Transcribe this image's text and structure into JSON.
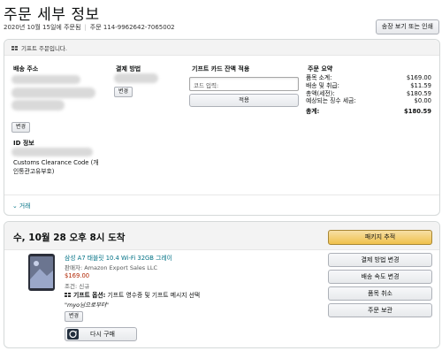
{
  "header": {
    "title": "주문 세부 정보",
    "order_date": "2020년 10월 15일에 주문됨",
    "order_number": "주문 114-9962642-7065002",
    "invoice_button": "송장 보기 또는 인쇄"
  },
  "gift_notice": "기프트 주문입니다.",
  "shipping": {
    "heading": "배송 주소",
    "change_button": "변경",
    "id_heading": "ID 정보",
    "customs_text": "Customs Clearance Code (개인통관고유부호)"
  },
  "payment": {
    "heading": "결제 방법",
    "change_button": "변경"
  },
  "gift_card": {
    "heading": "기프트 카드 잔액 적용",
    "placeholder": "코드 입력:",
    "apply_button": "적용"
  },
  "summary": {
    "heading": "주문 요약",
    "rows": [
      {
        "label": "품목 소계:",
        "value": "$169.00"
      },
      {
        "label": "배송 및 취급:",
        "value": "$11.59"
      },
      {
        "label": "총액(세전):",
        "value": "$180.59"
      },
      {
        "label": "예상되는 징수 세금:",
        "value": "$0.00"
      }
    ],
    "total_label": "총계:",
    "total_value": "$180.59"
  },
  "transactions_link": "거래",
  "shipment": {
    "delivery_title": "수, 10월 28 오후 8시 도착",
    "track_button": "패키지 추적",
    "product_title": "삼성 A7 태블릿 10.4 Wi-Fi 32GB 그레이",
    "seller": "판매자: Amazon Export Sales LLC",
    "price": "$169.00",
    "condition": "조건: 신규",
    "gift_option_bold": "기프트 옵션:",
    "gift_option_text": "기프트 영수증 및 기프트 메시지 선택",
    "gift_message": "\"myo님으로부터\"",
    "change_button": "변경",
    "buy_again": "다시 구매",
    "side_buttons": [
      "결제 방법 변경",
      "배송 속도 변경",
      "품목 취소",
      "주문 보관"
    ]
  },
  "colors": {
    "link": "#007185",
    "price": "#b12704",
    "primary_button": "#f0c14b"
  }
}
